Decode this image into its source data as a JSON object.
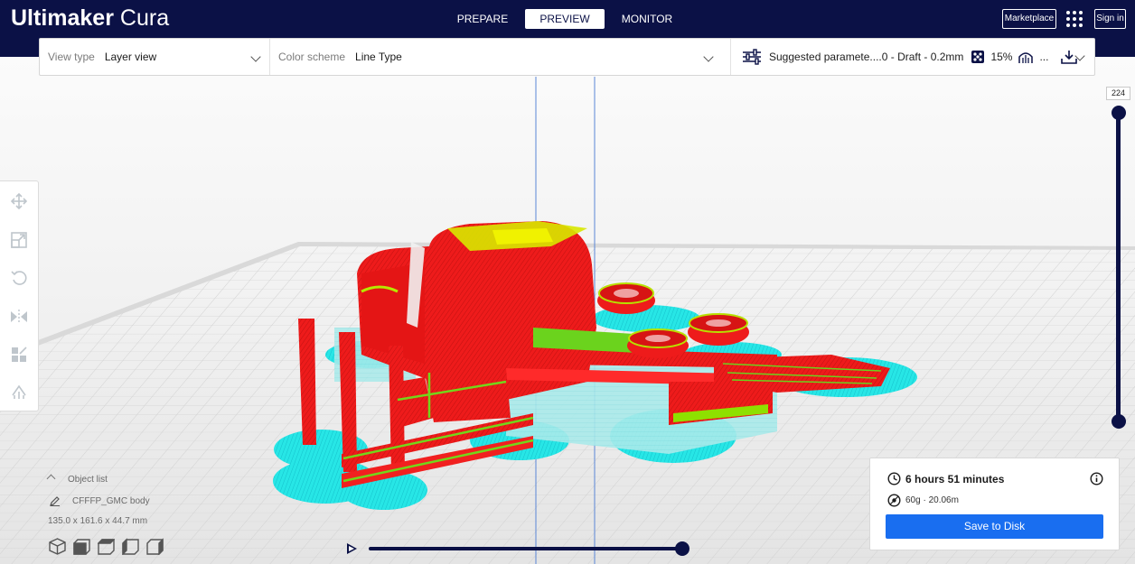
{
  "app": {
    "brand_bold": "Ultimaker",
    "brand_light": "Cura",
    "tabs": [
      {
        "label": "PREPARE",
        "active": false
      },
      {
        "label": "PREVIEW",
        "active": true
      },
      {
        "label": "MONITOR",
        "active": false
      }
    ],
    "marketplace_label": "Marketplace",
    "signin_label": "Sign in",
    "accent_color": "#0b1146",
    "button_color": "#196ef0"
  },
  "settings_bar": {
    "view_type_label": "View type",
    "view_type_value": "Layer view",
    "color_scheme_label": "Color scheme",
    "color_scheme_value": "Line Type",
    "print_setup_text": "Suggested paramete....0 - Draft - 0.2mm",
    "infill_percent": "15%",
    "support_indicator": "..."
  },
  "left_toolbar": {
    "tools": [
      "move-icon",
      "scale-icon",
      "rotate-icon",
      "mirror-icon",
      "per-model-settings-icon",
      "support-blocker-icon"
    ]
  },
  "layer_slider": {
    "current_layer": "224"
  },
  "object_list": {
    "title": "Object list",
    "object_name": "CFFFP_GMC body",
    "dimensions": "135.0 x 161.6 x 44.7 mm"
  },
  "camera_views": [
    "3d-view-icon",
    "front-view-icon",
    "top-view-icon",
    "left-view-icon",
    "right-view-icon"
  ],
  "print_estimate": {
    "time": "6 hours 51 minutes",
    "material": "60g · 20.06m",
    "save_label": "Save to Disk"
  },
  "simulation": {
    "progress": 1.0
  }
}
